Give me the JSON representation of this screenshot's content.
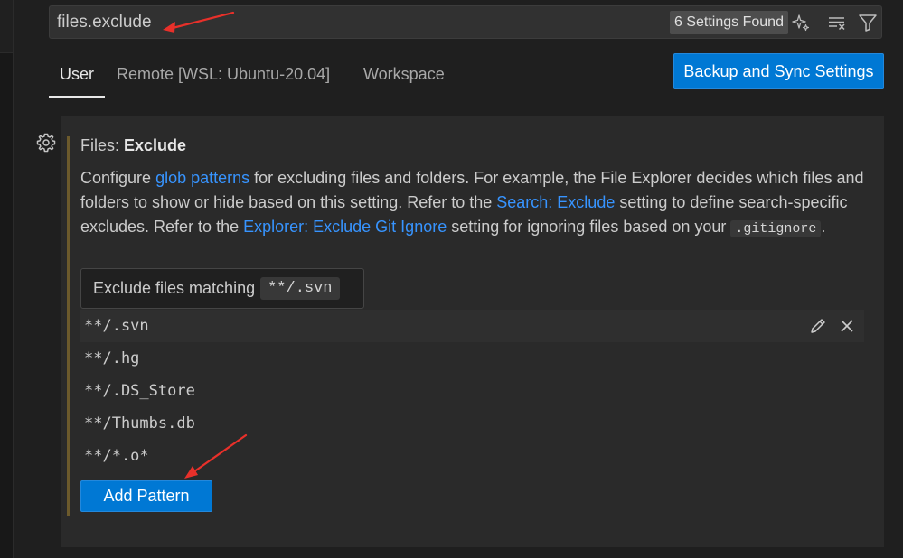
{
  "search": {
    "value": "files.exclude",
    "result_count": "6 Settings Found"
  },
  "icons": {
    "sparkle": "sparkle-icon",
    "clear_filter": "clear-filter-icon",
    "filter": "filter-icon",
    "gear": "gear-icon",
    "edit": "edit-pencil-icon",
    "remove": "close-icon"
  },
  "tabs": [
    {
      "label": "User",
      "active": true
    },
    {
      "label": "Remote [WSL: Ubuntu-20.04]",
      "active": false
    },
    {
      "label": "Workspace",
      "active": false
    }
  ],
  "sync_button": "Backup and Sync Settings",
  "setting": {
    "category": "Files: ",
    "name": "Exclude",
    "desc": {
      "p1": "Configure ",
      "link1": "glob patterns",
      "p2": " for excluding files and folders. For example, the File Explorer decides which files and folders to show or hide based on this setting. Refer to the ",
      "link2": "Search: Exclude",
      "p3": " setting to define search-specific excludes. Refer to the ",
      "link3": "Explorer: Exclude Git Ignore",
      "p4": " setting for ignoring files based on your ",
      "code": ".gitignore",
      "p5": "."
    },
    "tooltip": {
      "text": "Exclude files matching",
      "code": "**/.svn"
    },
    "patterns": [
      "**/.svn",
      "**/.hg",
      "**/.DS_Store",
      "**/Thumbs.db",
      "**/*.o*"
    ],
    "add_button": "Add Pattern"
  },
  "colors": {
    "accent": "#0078d4",
    "link": "#3794ff",
    "annotation": "#e8302a",
    "modified_indicator": "#6c5a2c"
  }
}
